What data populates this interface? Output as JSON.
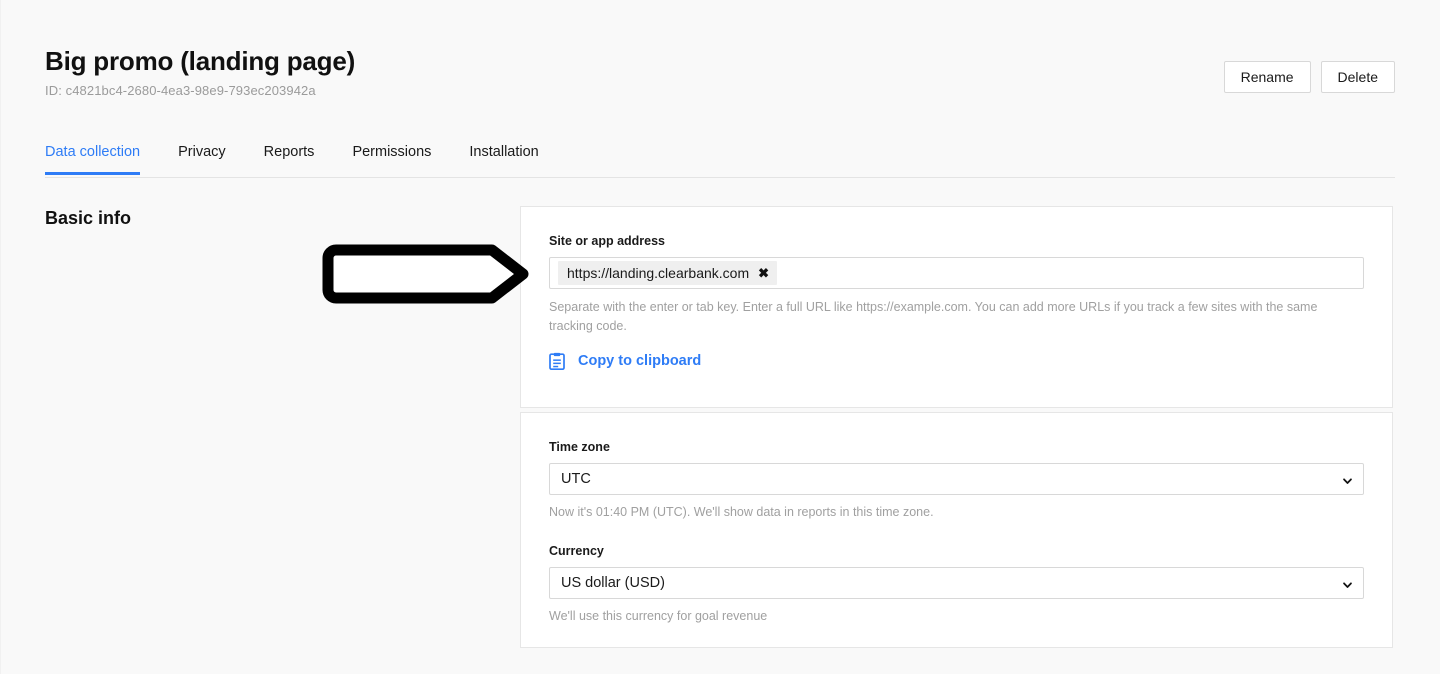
{
  "header": {
    "title": "Big promo (landing page)",
    "id_text": "ID: c4821bc4-2680-4ea3-98e9-793ec203942a",
    "rename_label": "Rename",
    "delete_label": "Delete"
  },
  "tabs": [
    {
      "label": "Data collection",
      "active": true
    },
    {
      "label": "Privacy",
      "active": false
    },
    {
      "label": "Reports",
      "active": false
    },
    {
      "label": "Permissions",
      "active": false
    },
    {
      "label": "Installation",
      "active": false
    }
  ],
  "section": {
    "title": "Basic info"
  },
  "basic_info": {
    "address_label": "Site or app address",
    "address_value": "https://landing.clearbank.com",
    "address_remove_glyph": "✖",
    "address_help": "Separate with the enter or tab key. Enter a full URL like https://example.com. You can add more URLs if you track a few sites with the same tracking code.",
    "copy_label": "Copy to clipboard",
    "copy_icon": "clipboard-icon"
  },
  "locale": {
    "timezone_label": "Time zone",
    "timezone_value": "UTC",
    "timezone_hint": "Now it's 01:40 PM (UTC). We'll show data in reports in this time zone.",
    "currency_label": "Currency",
    "currency_value": "US dollar (USD)",
    "currency_hint": "We'll use this currency for goal revenue"
  },
  "annotation": {
    "shape": "right-arrow-banner-outline",
    "stroke_color": "#000000",
    "fill_color": "#ffffff"
  },
  "colors": {
    "accent": "#2e7cf6",
    "page_bg": "#f9f9f9",
    "card_bg": "#ffffff",
    "border": "#e6e6e6",
    "muted_text": "#a0a0a0"
  }
}
